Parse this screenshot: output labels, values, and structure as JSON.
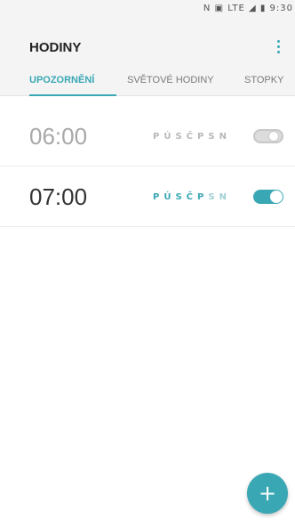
{
  "statusbar": {
    "icons_text": "N ▣ LTE ◢ ▮ 9:30"
  },
  "header": {
    "title": "HODINY",
    "menu_icon": "more-vertical-icon"
  },
  "tabs": [
    {
      "label": "UPOZORNĚNÍ",
      "active": true
    },
    {
      "label": "SVĚTOVÉ HODINY",
      "active": false
    },
    {
      "label": "STOPKY",
      "active": false
    }
  ],
  "alarms": [
    {
      "time": "06:00",
      "days": [
        "P",
        "Ú",
        "S",
        "Č",
        "P",
        "S",
        "N"
      ],
      "enabled": false
    },
    {
      "time": "07:00",
      "days": [
        "P",
        "Ú",
        "S",
        "Č",
        "P",
        "S",
        "N"
      ],
      "enabled": true
    }
  ],
  "fab": {
    "label": "+",
    "icon": "add-icon"
  },
  "colors": {
    "accent": "#3aa8b4",
    "header_bg": "#f4f4f4",
    "inactive": "#a8a8a8"
  }
}
